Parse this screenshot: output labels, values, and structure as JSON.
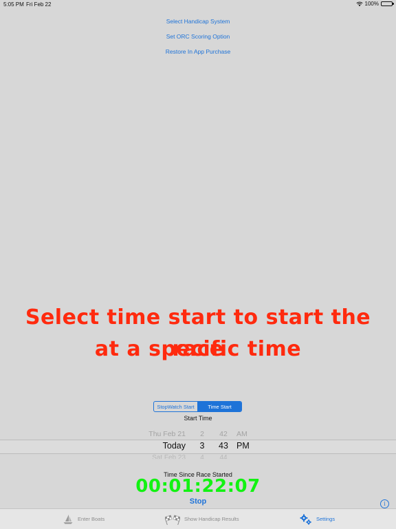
{
  "status_bar": {
    "time": "5:05 PM",
    "date": "Fri Feb 22",
    "battery": "100%",
    "battery_level": 1.0
  },
  "settings_links": {
    "handicap_system": "Select Handicap System",
    "orc_scoring": "Set ORC Scoring Option",
    "restore_purchase": "Restore In App Purchase"
  },
  "caption": {
    "line1": "Select time start to start the race",
    "line2": "at a specific time",
    "color": "#ff2a0e"
  },
  "start_mode": {
    "options": [
      "StopWatch Start",
      "Time Start"
    ],
    "selected": "Time Start"
  },
  "start_time": {
    "label": "Start Time",
    "picker": {
      "prev": {
        "date": "Thu Feb 21",
        "hour": "2",
        "minute": "42",
        "ampm": "AM"
      },
      "selected": {
        "date": "Today",
        "hour": "3",
        "minute": "43",
        "ampm": "PM"
      },
      "next": {
        "date": "Sat Feb 23",
        "hour": "4",
        "minute": "44"
      }
    }
  },
  "race_timer": {
    "label": "Time Since Race Started",
    "elapsed": "00:01:22:07",
    "stop_label": "Stop",
    "timer_color": "#12f212"
  },
  "info_icon": "info-icon",
  "tabs": [
    {
      "label": "Enter Boats",
      "icon": "sailboat-icon",
      "active": false
    },
    {
      "label": "Show Handicap Results",
      "icon": "checkered-flags-icon",
      "active": false
    },
    {
      "label": "Settings",
      "icon": "gears-icon",
      "active": true
    }
  ],
  "accent_color": "#1e73d8"
}
